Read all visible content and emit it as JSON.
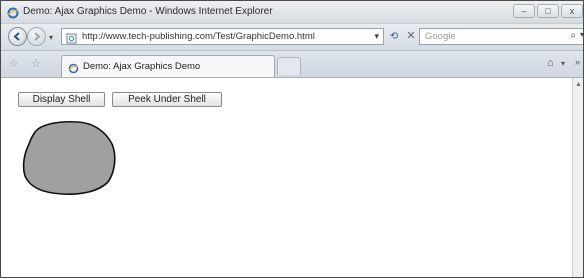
{
  "window": {
    "title": "Demo: Ajax Graphics Demo - Windows Internet Explorer",
    "controls": {
      "minimize": "–",
      "maximize": "□",
      "close": "x"
    }
  },
  "navbar": {
    "url": "http://www.tech-publishing.com/Test/GraphicDemo.html",
    "search_placeholder": "Google"
  },
  "tabs": {
    "active_tab_title": "Demo: Ajax Graphics Demo"
  },
  "page": {
    "buttons": {
      "display_shell": "Display Shell",
      "peek_under_shell": "Peek Under Shell"
    },
    "shape_fill": "#a0a0a0",
    "shape_stroke": "#111111"
  }
}
